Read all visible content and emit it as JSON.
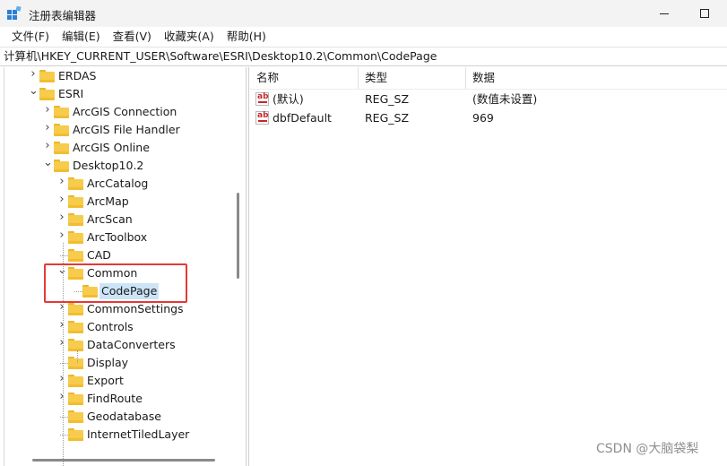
{
  "window": {
    "title": "注册表编辑器",
    "minimize_icon": "minimize-icon",
    "maximize_icon": "maximize-icon"
  },
  "menu": [
    "文件(F)",
    "编辑(E)",
    "查看(V)",
    "收藏夹(A)",
    "帮助(H)"
  ],
  "address": "计算机\\HKEY_CURRENT_USER\\Software\\ESRI\\Desktop10.2\\Common\\CodePage",
  "tree": [
    {
      "label": "ERDAS",
      "expand": "collapsed"
    },
    {
      "label": "ESRI",
      "expand": "expanded"
    },
    {
      "label": "ArcGIS Connection",
      "expand": "collapsed"
    },
    {
      "label": "ArcGIS File Handler",
      "expand": "collapsed"
    },
    {
      "label": "ArcGIS Online",
      "expand": "collapsed"
    },
    {
      "label": "Desktop10.2",
      "expand": "expanded"
    },
    {
      "label": "ArcCatalog",
      "expand": "collapsed"
    },
    {
      "label": "ArcMap",
      "expand": "collapsed"
    },
    {
      "label": "ArcScan",
      "expand": "collapsed"
    },
    {
      "label": "ArcToolbox",
      "expand": "collapsed"
    },
    {
      "label": "CAD",
      "expand": "none"
    },
    {
      "label": "Common",
      "expand": "expanded"
    },
    {
      "label": "CodePage",
      "expand": "none",
      "selected": true
    },
    {
      "label": "CommonSettings",
      "expand": "collapsed"
    },
    {
      "label": "Controls",
      "expand": "collapsed"
    },
    {
      "label": "DataConverters",
      "expand": "collapsed"
    },
    {
      "label": "Display",
      "expand": "none"
    },
    {
      "label": "Export",
      "expand": "collapsed"
    },
    {
      "label": "FindRoute",
      "expand": "collapsed"
    },
    {
      "label": "Geodatabase",
      "expand": "none"
    },
    {
      "label": "InternetTiledLayer",
      "expand": "none"
    }
  ],
  "list": {
    "columns": [
      "名称",
      "类型",
      "数据"
    ],
    "rows": [
      {
        "name": "(默认)",
        "type": "REG_SZ",
        "data": "(数值未设置)",
        "icon": "string-value-icon"
      },
      {
        "name": "dbfDefault",
        "type": "REG_SZ",
        "data": "969",
        "icon": "string-value-icon"
      }
    ]
  },
  "colors": {
    "highlight_box": "#e53935",
    "selection": "#cce4f7",
    "folder": "#f7cb4c"
  },
  "watermark": "CSDN @大脑袋梨"
}
